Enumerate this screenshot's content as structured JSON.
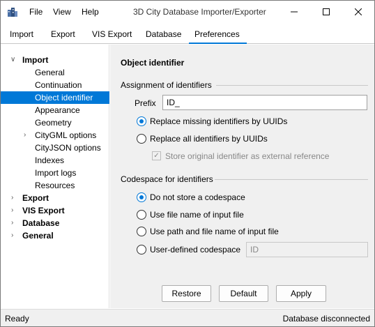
{
  "window": {
    "title": "3D City Database Importer/Exporter",
    "menu": [
      "File",
      "View",
      "Help"
    ]
  },
  "tabs": [
    "Import",
    "Export",
    "VIS Export",
    "Database",
    "Preferences"
  ],
  "active_tab": "Preferences",
  "tree": {
    "import": "Import",
    "children": [
      "General",
      "Continuation",
      "Object identifier",
      "Appearance",
      "Geometry",
      "CityGML options",
      "CityJSON options",
      "Indexes",
      "Import logs",
      "Resources"
    ],
    "selected": "Object identifier",
    "others": [
      "Export",
      "VIS Export",
      "Database",
      "General"
    ]
  },
  "panel": {
    "title": "Object identifier",
    "assignment": {
      "title": "Assignment of identifiers",
      "prefix_label": "Prefix",
      "prefix_value": "ID_",
      "options": [
        "Replace missing identifiers by UUIDs",
        "Replace all identifiers by UUIDs"
      ],
      "selected_index": 0,
      "store_original_label": "Store original identifier as external reference",
      "store_original_checked": true
    },
    "codespace": {
      "title": "Codespace for identifiers",
      "options": [
        "Do not store a codespace",
        "Use file name of input file",
        "Use path and file name of input file",
        "User-defined codespace"
      ],
      "selected_index": 0,
      "user_defined_value": "ID"
    },
    "buttons": {
      "restore": "Restore",
      "default": "Default",
      "apply": "Apply"
    }
  },
  "status": {
    "left": "Ready",
    "right": "Database disconnected"
  },
  "colors": {
    "accent": "#0078d7"
  }
}
